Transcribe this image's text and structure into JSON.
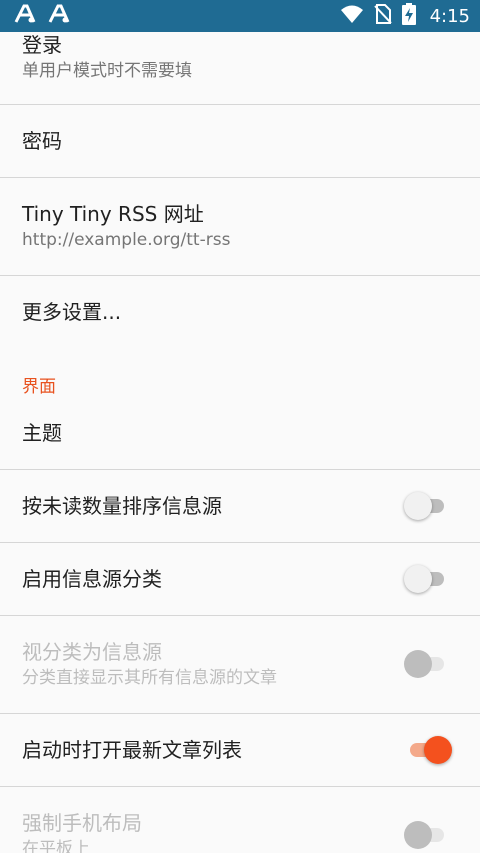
{
  "status_bar": {
    "time": "4:15",
    "icons": [
      "android-a-icon",
      "android-a-icon",
      "wifi-icon",
      "no-sim-icon",
      "battery-charging-icon"
    ]
  },
  "colors": {
    "status_bar": "#1f6b93",
    "accent": "#e8521f",
    "switch_on_thumb": "#f4511e",
    "switch_on_track": "#f4a98a"
  },
  "settings": {
    "login": {
      "title": "登录",
      "summary": "单用户模式时不需要填"
    },
    "password": {
      "title": "密码"
    },
    "url": {
      "title": "Tiny Tiny RSS 网址",
      "summary": "http://example.org/tt-rss"
    },
    "more": {
      "title": "更多设置..."
    },
    "interface_category": "界面",
    "theme": {
      "title": "主题"
    },
    "sort_feeds": {
      "title": "按未读数量排序信息源",
      "checked": false,
      "enabled": true
    },
    "enable_cats": {
      "title": "启用信息源分类",
      "checked": false,
      "enabled": true
    },
    "browse_cats": {
      "title": "视分类为信息源",
      "summary": "分类直接显示其所有信息源的文章",
      "checked": false,
      "enabled": false
    },
    "open_fresh": {
      "title": "启动时打开最新文章列表",
      "checked": true,
      "enabled": true
    },
    "force_phone": {
      "title": "强制手机布局",
      "summary": "在平板上",
      "checked": false,
      "enabled": false
    }
  }
}
